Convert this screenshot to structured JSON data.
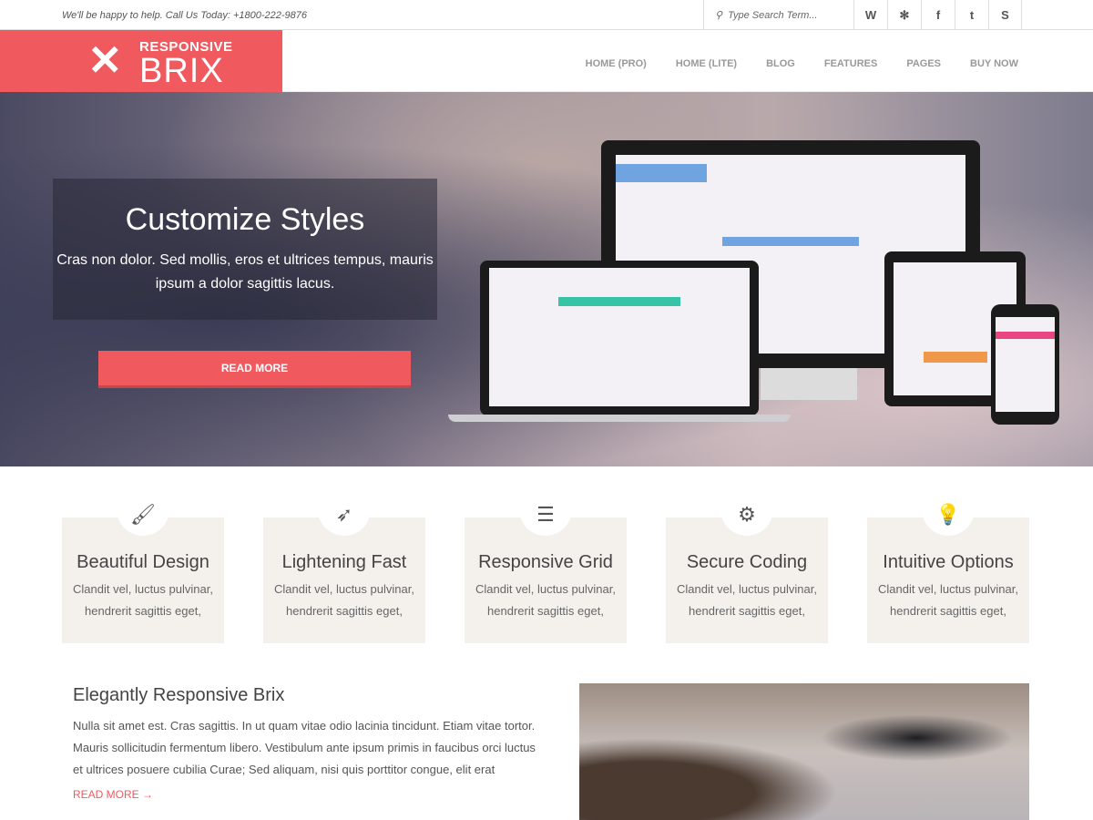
{
  "topbar": {
    "tagline": "We'll be happy to help. Call Us Today: +1800-222-9876",
    "search_placeholder": "Type Search Term...",
    "socials": [
      "wordpress-icon",
      "yelp-icon",
      "facebook-icon",
      "twitter-icon",
      "skype-icon"
    ]
  },
  "logo": {
    "top": "RESPONSIVE",
    "bottom": "BRIX"
  },
  "nav": [
    "HOME (PRO)",
    "HOME (LITE)",
    "BLOG",
    "FEATURES",
    "PAGES",
    "BUY NOW"
  ],
  "hero": {
    "title": "Customize Styles",
    "text": "Cras non dolor. Sed mollis, eros et ultrices tempus, mauris ipsum a dolor sagittis lacus.",
    "button": "READ MORE"
  },
  "features": [
    {
      "icon": "paintbrush-icon",
      "title": "Beautiful Design",
      "text": "Clandit vel, luctus pulvinar, hendrerit sagittis eget,"
    },
    {
      "icon": "rocket-icon",
      "title": "Lightening Fast",
      "text": "Clandit vel, luctus pulvinar, hendrerit sagittis eget,"
    },
    {
      "icon": "database-icon",
      "title": "Responsive Grid",
      "text": "Clandit vel, luctus pulvinar, hendrerit sagittis eget,"
    },
    {
      "icon": "gears-icon",
      "title": "Secure Coding",
      "text": "Clandit vel, luctus pulvinar, hendrerit sagittis eget,"
    },
    {
      "icon": "lightbulb-icon",
      "title": "Intuitive Options",
      "text": "Clandit vel, luctus pulvinar, hendrerit sagittis eget,"
    }
  ],
  "about": {
    "title": "Elegantly Responsive Brix",
    "text": "Nulla sit amet est. Cras sagittis. In ut quam vitae odio lacinia tincidunt. Etiam vitae tortor. Mauris sollicitudin fermentum libero. Vestibulum ante ipsum primis in faucibus orci luctus et ultrices posuere cubilia Curae; Sed aliquam, nisi quis porttitor congue, elit erat",
    "link": "READ MORE →"
  },
  "colors": {
    "accent": "#f05a5e",
    "card": "#f4f1ec"
  }
}
